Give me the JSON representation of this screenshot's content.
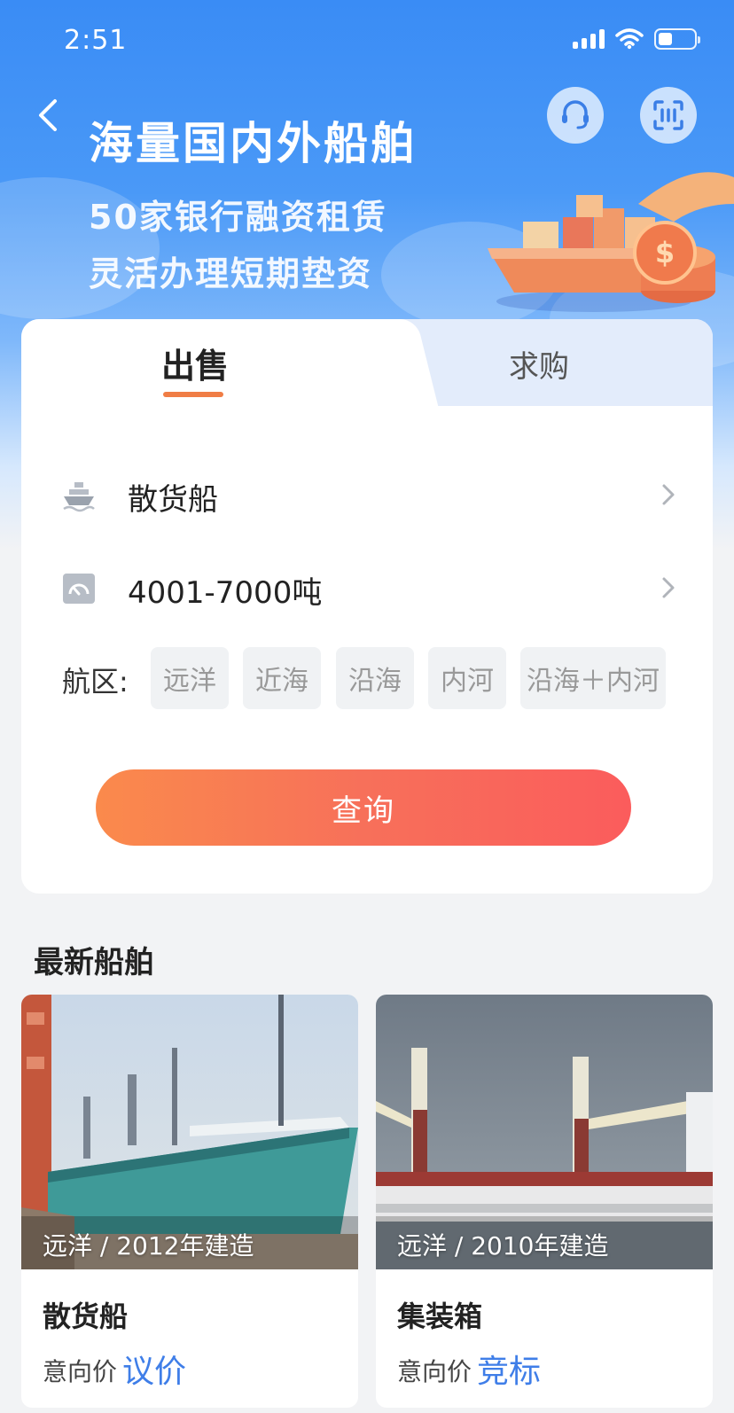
{
  "status_bar": {
    "time": "2:51"
  },
  "hero": {
    "title": "海量国内外船舶",
    "line1": "50家银行融资租赁",
    "line2": "灵活办理短期垫资"
  },
  "tabs": {
    "sell": "出售",
    "buy": "求购",
    "active": "sell"
  },
  "form": {
    "ship_type": "散货船",
    "tonnage": "4001-7000吨",
    "region_label": "航区:",
    "regions": [
      "远洋",
      "近海",
      "沿海",
      "内河",
      "沿海＋内河"
    ],
    "query_label": "查询"
  },
  "latest": {
    "title": "最新船舶",
    "items": [
      {
        "meta": "远洋 / 2012年建造",
        "name": "散货船",
        "price_label": "意向价",
        "price_value": "议价"
      },
      {
        "meta": "远洋 / 2010年建造",
        "name": "集装箱",
        "price_label": "意向价",
        "price_value": "竞标"
      }
    ]
  },
  "colors": {
    "accent_blue": "#3f7ee8",
    "button_orange": "#fa8a4c",
    "button_red": "#fb5c5c",
    "tab_underline": "#f07d45"
  }
}
